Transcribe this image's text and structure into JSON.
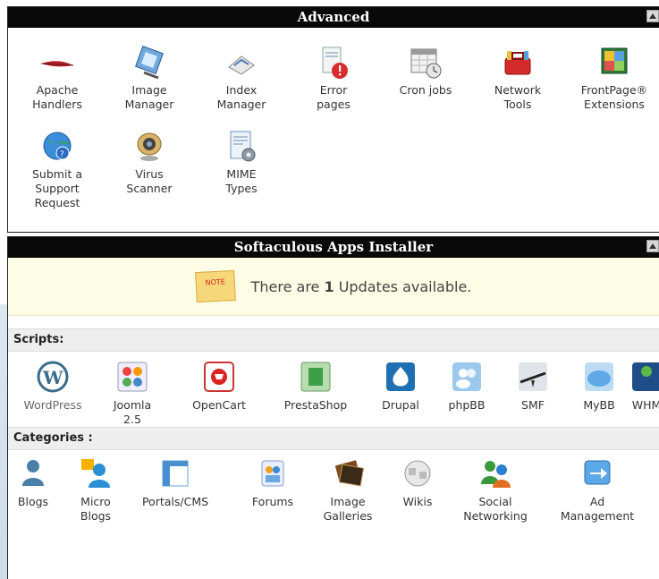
{
  "advanced": {
    "title": "Advanced",
    "items": [
      {
        "label": "Apache\nHandlers",
        "icon": "feather-icon"
      },
      {
        "label": "Image\nManager",
        "icon": "image-manager-icon"
      },
      {
        "label": "Index\nManager",
        "icon": "index-manager-icon"
      },
      {
        "label": "Error\npages",
        "icon": "error-pages-icon"
      },
      {
        "label": "Cron jobs",
        "icon": "calendar-clock-icon"
      },
      {
        "label": "Network\nTools",
        "icon": "toolbox-icon"
      },
      {
        "label": "FrontPage®\nExtensions",
        "icon": "puzzle-icon"
      },
      {
        "label": "Submit a\nSupport\nRequest",
        "icon": "support-globe-icon"
      },
      {
        "label": "Virus\nScanner",
        "icon": "webcam-icon"
      },
      {
        "label": "MIME\nTypes",
        "icon": "document-gear-icon"
      }
    ]
  },
  "softaculous": {
    "title": "Softaculous Apps Installer",
    "notice_pre": "There are ",
    "notice_count": "1",
    "notice_post": " Updates available.",
    "note_badge": "NOTE",
    "scripts_label": "Scripts:",
    "scripts": [
      {
        "label": "WordPress"
      },
      {
        "label": "Joomla\n2.5"
      },
      {
        "label": "OpenCart"
      },
      {
        "label": "PrestaShop"
      },
      {
        "label": "Drupal"
      },
      {
        "label": "phpBB"
      },
      {
        "label": "SMF"
      },
      {
        "label": "MyBB"
      },
      {
        "label": "WHM"
      }
    ],
    "categories_label": "Categories :",
    "categories": [
      {
        "label": "Blogs"
      },
      {
        "label": "Micro\nBlogs"
      },
      {
        "label": "Portals/CMS"
      },
      {
        "label": "Forums"
      },
      {
        "label": "Image\nGalleries"
      },
      {
        "label": "Wikis"
      },
      {
        "label": "Social\nNetworking"
      },
      {
        "label": "Ad\nManagement"
      }
    ]
  }
}
